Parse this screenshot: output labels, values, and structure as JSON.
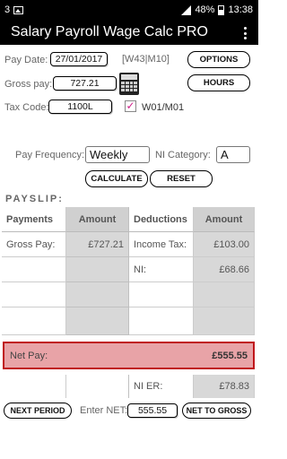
{
  "status": {
    "notification_count": "3",
    "battery": "48%",
    "time": "13:38"
  },
  "app": {
    "title": "Salary Payroll Wage Calc PRO"
  },
  "form": {
    "pay_date_label": "Pay Date:",
    "pay_date_value": "27/01/2017",
    "week_month": "[W43|M10]",
    "options_label": "OPTIONS",
    "gross_pay_label": "Gross pay:",
    "gross_pay_value": "727.21",
    "hours_label": "HOURS",
    "tax_code_label": "Tax Code:",
    "tax_code_value": "1100L",
    "w01_checked": true,
    "w01_label": "W01/M01",
    "pay_frequency_label": "Pay Frequency:",
    "pay_frequency_value": "Weekly",
    "ni_category_label": "NI Category:",
    "ni_category_value": "A",
    "calculate_label": "CALCULATE",
    "reset_label": "RESET"
  },
  "payslip": {
    "title": "PAYSLIP:",
    "headers": {
      "payments": "Payments",
      "amount1": "Amount",
      "deductions": "Deductions",
      "amount2": "Amount"
    },
    "rows": [
      {
        "payment": "Gross Pay:",
        "payment_amount": "£727.21",
        "deduction": "Income Tax:",
        "deduction_amount": "£103.00"
      },
      {
        "payment": "",
        "payment_amount": "",
        "deduction": "NI:",
        "deduction_amount": "£68.66"
      },
      {
        "payment": "",
        "payment_amount": "",
        "deduction": "",
        "deduction_amount": ""
      }
    ],
    "net_pay_label": "Net Pay:",
    "net_pay_value": "£555.55",
    "ni_er_label": "NI ER:",
    "ni_er_value": "£78.83"
  },
  "bottom": {
    "next_period_label": "NEXT PERIOD",
    "enter_net_label": "Enter NET:",
    "enter_net_value": "555.55",
    "net_to_gross_label": "NET TO GROSS"
  },
  "colors": {
    "net_pay_bg": "#e8a3a7",
    "net_pay_border": "#c0161b",
    "checkbox_tick": "#d0208a"
  }
}
